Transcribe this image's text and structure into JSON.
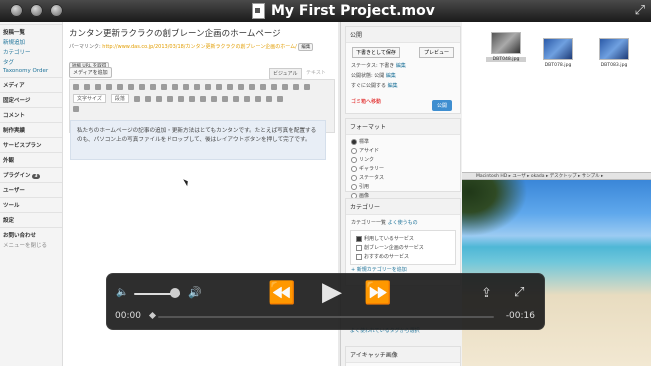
{
  "window": {
    "title": "My First Project.mov",
    "file_icon": "movie-file-icon"
  },
  "wp_sidebar": {
    "items": [
      {
        "label": "投稿一覧",
        "style": "dark"
      },
      {
        "label": "新規追加",
        "style": "link"
      },
      {
        "label": "カテゴリー",
        "style": "link"
      },
      {
        "label": "タグ",
        "style": "link"
      },
      {
        "label": "Taxonomy Order",
        "style": "link"
      },
      {
        "label": "メディア",
        "style": "dark"
      },
      {
        "label": "固定ページ",
        "style": "dark"
      },
      {
        "label": "コメント",
        "style": "dark"
      },
      {
        "label": "制作実績",
        "style": "dark"
      },
      {
        "label": "サービスプラン",
        "style": "dark"
      },
      {
        "label": "外観",
        "style": "dark"
      },
      {
        "label": "プラグイン",
        "style": "dark",
        "badge": "3"
      },
      {
        "label": "ユーザー",
        "style": "dark"
      },
      {
        "label": "ツール",
        "style": "dark"
      },
      {
        "label": "設定",
        "style": "dark"
      },
      {
        "label": "お問い合わせ",
        "style": "dark"
      },
      {
        "label": "メニューを閉じる",
        "style": "grey"
      }
    ]
  },
  "editor": {
    "page_title": "カンタン更新ラクラクの創ブレーン企画のホームページ",
    "permalink_label": "パーマリンク:",
    "permalink_url": "http://www.das.co.jp/2013/03/18/カンタン更新ラクラクの創ブレーン企画のホーム/",
    "edit_btn": "編集",
    "getlink_btn": "短縮 URL を取得",
    "media_btn": "メディアを追加",
    "tab_visual": "ビジュアル",
    "tab_text": "テキスト",
    "font_size_select": "文字サイズ",
    "format_select": "段落",
    "body_text": "私たちのホームページの記事の追加・更新方法はとてもカンタンです。たとえば写真を配置するのも、パソコン上の写真ファイルをドロップして、後はレイアウトボタンを押して完了です。"
  },
  "publish_box": {
    "head": "公開",
    "save_draft": "下書きとして保存",
    "preview": "プレビュー",
    "status": "ステータス: 下書き",
    "status_edit": "編集",
    "visibility": "公開状態: 公開",
    "visibility_edit": "編集",
    "schedule": "すぐに公開する",
    "schedule_edit": "編集",
    "trash": "ゴミ箱へ移動",
    "publish_btn": "公開"
  },
  "format_box": {
    "head": "フォーマット",
    "options": [
      "標準",
      "アサイド",
      "リンク",
      "ギャラリー",
      "ステータス",
      "引用",
      "画像"
    ],
    "selected": 0
  },
  "category_box": {
    "head": "カテゴリー",
    "tab_all": "カテゴリー一覧",
    "tab_popular": "よく使うもの",
    "items": [
      {
        "label": "利用しているサービス",
        "checked": true
      },
      {
        "label": "創ブレーン企画のサービス",
        "checked": false
      },
      {
        "label": "おすすめのサービス",
        "checked": false
      }
    ],
    "add_new": "+ 新規カテゴリーを追加"
  },
  "tags_box": {
    "link": "よく使われているタグから選択"
  },
  "thumb_box": {
    "head": "アイキャッチ画像"
  },
  "desktop": {
    "files": [
      {
        "name": "DBT048.jpg",
        "selected": true
      },
      {
        "name": "DBT078.jpg",
        "selected": false
      },
      {
        "name": "DBT083.jpg",
        "selected": false
      }
    ],
    "path_bar": "Macintosh HD ▸ ユーザ ▸ okada ▸ デスクトップ ▸ サンプル ▸"
  },
  "player": {
    "current_time": "00:00",
    "remaining_time": "-00:16",
    "progress": 0.0,
    "volume": 0.9
  }
}
